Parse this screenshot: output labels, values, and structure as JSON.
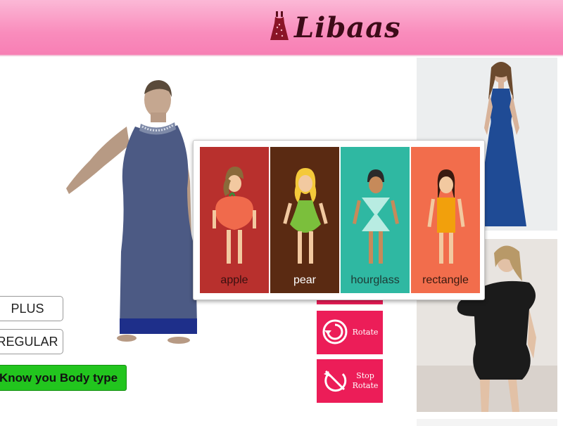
{
  "header": {
    "brand": "Libaas",
    "logo_icon": "dress-icon",
    "color": "#f98cbc"
  },
  "sidebar": {
    "plus_label": "PLUS",
    "regular_label": "REGULAR",
    "body_type_label": "Know you Body type"
  },
  "controls": {
    "rotate_label": "Rotate",
    "stop_line1": "Stop",
    "stop_line2": "Rotate",
    "rotate_icon": "rotate-icon",
    "stop_icon": "stop-rotate-icon",
    "accent": "#ec1d58"
  },
  "body_types": {
    "items": [
      {
        "label": "apple",
        "bg": "#b8302d",
        "text_color": "#3a1010"
      },
      {
        "label": "pear",
        "bg": "#5a2a12",
        "text_color": "#ffffff"
      },
      {
        "label": "hourglass",
        "bg": "#2fb8a2",
        "text_color": "#1d3a35"
      },
      {
        "label": "rectangle",
        "bg": "#f26d4c",
        "text_color": "#3a1a10"
      }
    ]
  },
  "products": [
    {
      "description_icon": "blue-halter-maxi-dress-icon"
    },
    {
      "description_icon": "black-ruffle-mini-dress-icon"
    }
  ]
}
